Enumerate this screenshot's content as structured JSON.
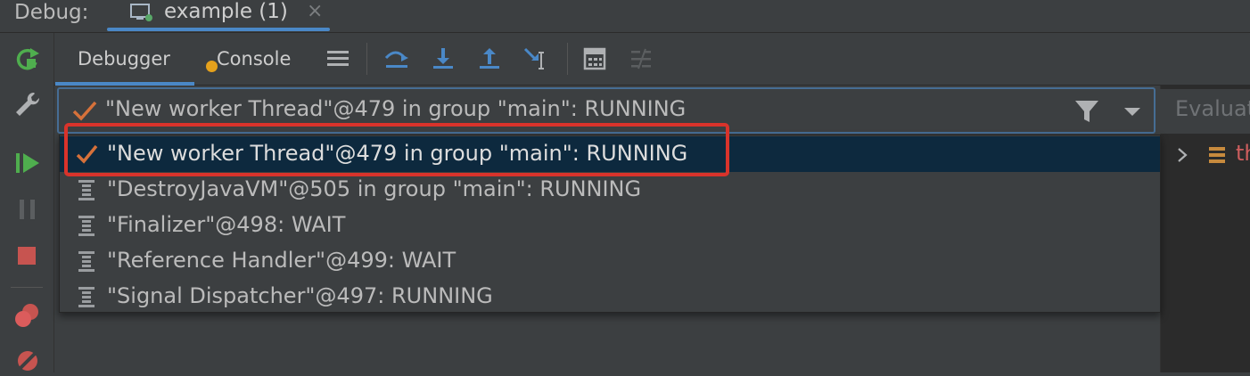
{
  "title_label": "Debug:",
  "run_tab": {
    "label": "example (1)",
    "close": "×"
  },
  "tabs": {
    "debugger": "Debugger",
    "console": "Console"
  },
  "thread_selector": {
    "current": "\"New worker Thread\"@479 in group \"main\": RUNNING",
    "icons": [
      "filter-icon",
      "chevron-down-icon"
    ]
  },
  "threads": [
    {
      "label": "\"New worker Thread\"@479 in group \"main\": RUNNING",
      "selected": true,
      "icon": "checkmark-icon"
    },
    {
      "label": "\"DestroyJavaVM\"@505 in group \"main\": RUNNING",
      "selected": false,
      "icon": "thread-icon"
    },
    {
      "label": "\"Finalizer\"@498: WAIT",
      "selected": false,
      "icon": "thread-icon"
    },
    {
      "label": "\"Reference Handler\"@499: WAIT",
      "selected": false,
      "icon": "thread-icon"
    },
    {
      "label": "\"Signal Dispatcher\"@497: RUNNING",
      "selected": false,
      "icon": "thread-icon"
    }
  ],
  "evaluate": {
    "placeholder": "Evaluate"
  },
  "variables": {
    "first_item": "th"
  },
  "colors": {
    "accent": "#4a88c7",
    "highlight": "#d9332b",
    "check": "#d6713a",
    "resume_green": "#4fae4e",
    "stop_red": "#c75450",
    "selected_row": "#0d293e"
  }
}
